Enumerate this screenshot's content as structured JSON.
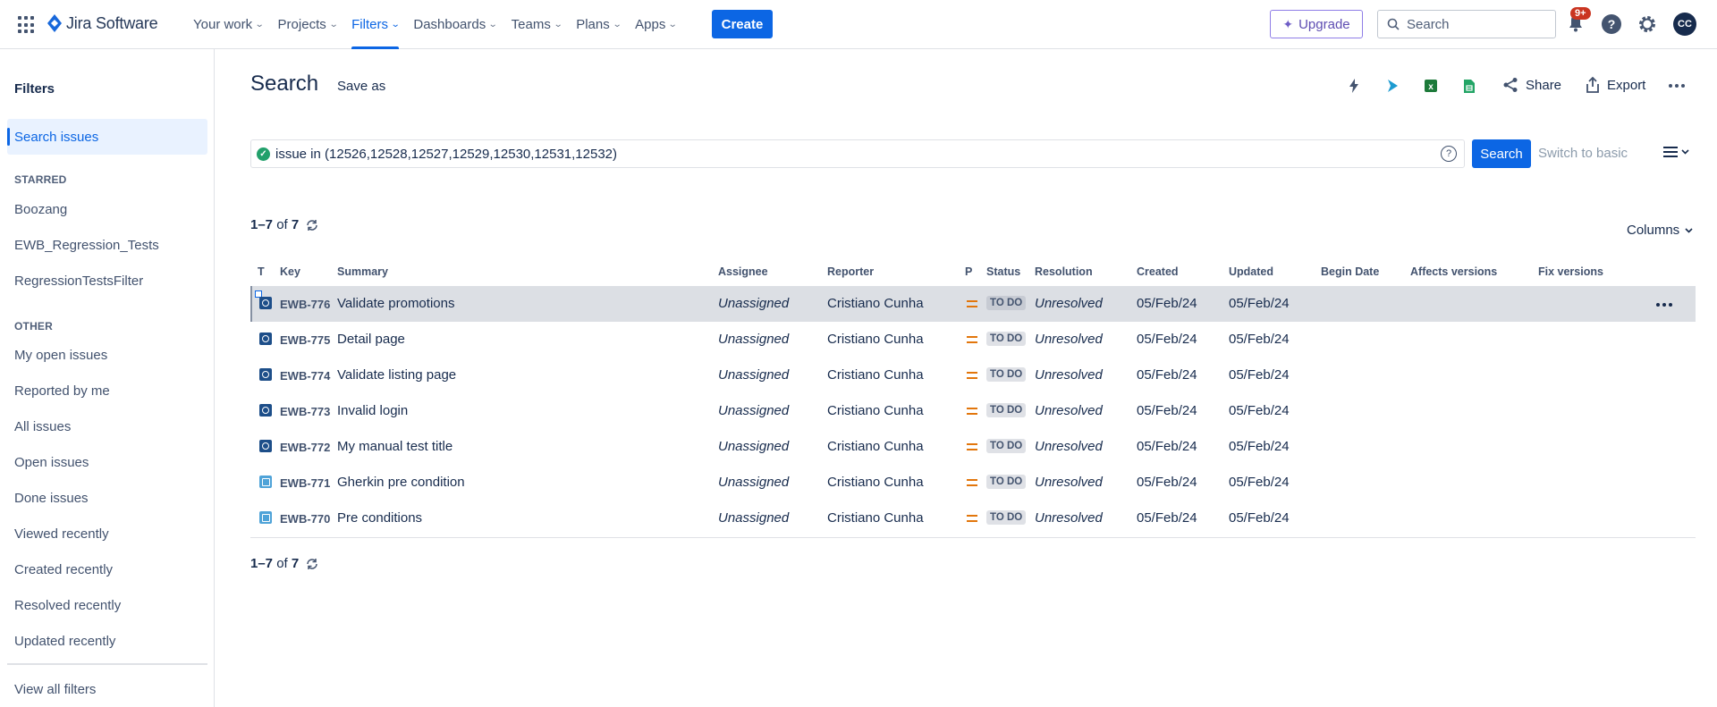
{
  "app": {
    "name": "Jira Software"
  },
  "nav": {
    "items": [
      {
        "label": "Your work"
      },
      {
        "label": "Projects"
      },
      {
        "label": "Filters"
      },
      {
        "label": "Dashboards"
      },
      {
        "label": "Teams"
      },
      {
        "label": "Plans"
      },
      {
        "label": "Apps"
      }
    ],
    "active": "Filters",
    "create_label": "Create",
    "upgrade_label": "Upgrade",
    "search_placeholder": "Search",
    "notifications_badge": "9+",
    "avatar_initials": "CC"
  },
  "sidebar": {
    "title": "Filters",
    "active_item": "Search issues",
    "starred_heading": "STARRED",
    "starred": [
      "Boozang",
      "EWB_Regression_Tests",
      "RegressionTestsFilter"
    ],
    "other_heading": "OTHER",
    "other": [
      "My open issues",
      "Reported by me",
      "All issues",
      "Open issues",
      "Done issues",
      "Viewed recently",
      "Created recently",
      "Resolved recently",
      "Updated recently"
    ],
    "view_all": "View all filters"
  },
  "main": {
    "title": "Search",
    "save_as": "Save as",
    "share": "Share",
    "export": "Export",
    "jql": "issue in (12526,12528,12527,12529,12530,12531,12532)",
    "search_button": "Search",
    "switch_basic": "Switch to basic",
    "count_range": "1–7",
    "count_of": "of",
    "count_total": "7",
    "columns_label": "Columns"
  },
  "table": {
    "headers": {
      "t": "T",
      "key": "Key",
      "summary": "Summary",
      "assignee": "Assignee",
      "reporter": "Reporter",
      "p": "P",
      "status": "Status",
      "resolution": "Resolution",
      "created": "Created",
      "updated": "Updated",
      "begin_date": "Begin Date",
      "affects": "Affects versions",
      "fix": "Fix versions"
    },
    "rows": [
      {
        "type": "test",
        "key": "EWB-776",
        "summary": "Validate promotions",
        "assignee": "Unassigned",
        "reporter": "Cristiano Cunha",
        "status": "TO DO",
        "resolution": "Unresolved",
        "created": "05/Feb/24",
        "updated": "05/Feb/24"
      },
      {
        "type": "test",
        "key": "EWB-775",
        "summary": "Detail page",
        "assignee": "Unassigned",
        "reporter": "Cristiano Cunha",
        "status": "TO DO",
        "resolution": "Unresolved",
        "created": "05/Feb/24",
        "updated": "05/Feb/24"
      },
      {
        "type": "test",
        "key": "EWB-774",
        "summary": "Validate listing page",
        "assignee": "Unassigned",
        "reporter": "Cristiano Cunha",
        "status": "TO DO",
        "resolution": "Unresolved",
        "created": "05/Feb/24",
        "updated": "05/Feb/24"
      },
      {
        "type": "test",
        "key": "EWB-773",
        "summary": "Invalid login",
        "assignee": "Unassigned",
        "reporter": "Cristiano Cunha",
        "status": "TO DO",
        "resolution": "Unresolved",
        "created": "05/Feb/24",
        "updated": "05/Feb/24"
      },
      {
        "type": "test",
        "key": "EWB-772",
        "summary": "My manual test title",
        "assignee": "Unassigned",
        "reporter": "Cristiano Cunha",
        "status": "TO DO",
        "resolution": "Unresolved",
        "created": "05/Feb/24",
        "updated": "05/Feb/24"
      },
      {
        "type": "precondition",
        "key": "EWB-771",
        "summary": "Gherkin pre condition",
        "assignee": "Unassigned",
        "reporter": "Cristiano Cunha",
        "status": "TO DO",
        "resolution": "Unresolved",
        "created": "05/Feb/24",
        "updated": "05/Feb/24"
      },
      {
        "type": "precondition",
        "key": "EWB-770",
        "summary": "Pre conditions",
        "assignee": "Unassigned",
        "reporter": "Cristiano Cunha",
        "status": "TO DO",
        "resolution": "Unresolved",
        "created": "05/Feb/24",
        "updated": "05/Feb/24"
      }
    ]
  },
  "colors": {
    "brand": "#0c66e4",
    "priority_medium": "#e2760c",
    "selected_row": "#dcdfe4"
  }
}
